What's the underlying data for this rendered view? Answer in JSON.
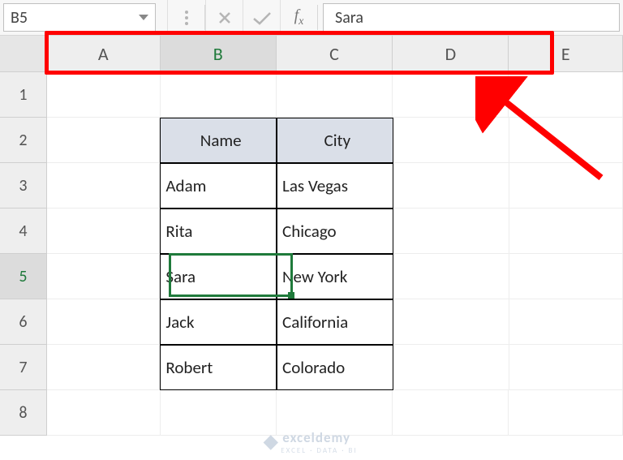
{
  "namebox": {
    "value": "B5"
  },
  "formula_bar": {
    "value": "Sara",
    "fx_label": "fx"
  },
  "columns": [
    {
      "label": "A",
      "width": 151,
      "active": false
    },
    {
      "label": "B",
      "width": 155,
      "active": true
    },
    {
      "label": "C",
      "width": 155,
      "active": false
    },
    {
      "label": "D",
      "width": 155,
      "active": false
    },
    {
      "label": "E",
      "width": 152,
      "active": false
    }
  ],
  "rows": [
    {
      "label": "1",
      "active": false
    },
    {
      "label": "2",
      "active": false
    },
    {
      "label": "3",
      "active": false
    },
    {
      "label": "4",
      "active": false
    },
    {
      "label": "5",
      "active": true
    },
    {
      "label": "6",
      "active": false
    },
    {
      "label": "7",
      "active": false
    },
    {
      "label": "8",
      "active": false
    }
  ],
  "active_cell": {
    "ref": "B5",
    "col_index": 1,
    "row_index": 4
  },
  "table": {
    "headers": [
      "Name",
      "City"
    ],
    "rows": [
      [
        "Adam",
        "Las Vegas"
      ],
      [
        "Rita",
        "Chicago"
      ],
      [
        "Sara",
        "New York"
      ],
      [
        "Jack",
        "California"
      ],
      [
        "Robert",
        "Colorado"
      ]
    ]
  },
  "watermark": {
    "brand": "exceldemy",
    "tagline": "EXCEL · DATA · BI"
  },
  "chart_data": {
    "type": "table",
    "title": "",
    "columns": [
      "Name",
      "City"
    ],
    "rows": [
      [
        "Adam",
        "Las Vegas"
      ],
      [
        "Rita",
        "Chicago"
      ],
      [
        "Sara",
        "New York"
      ],
      [
        "Jack",
        "California"
      ],
      [
        "Robert",
        "Colorado"
      ]
    ]
  }
}
